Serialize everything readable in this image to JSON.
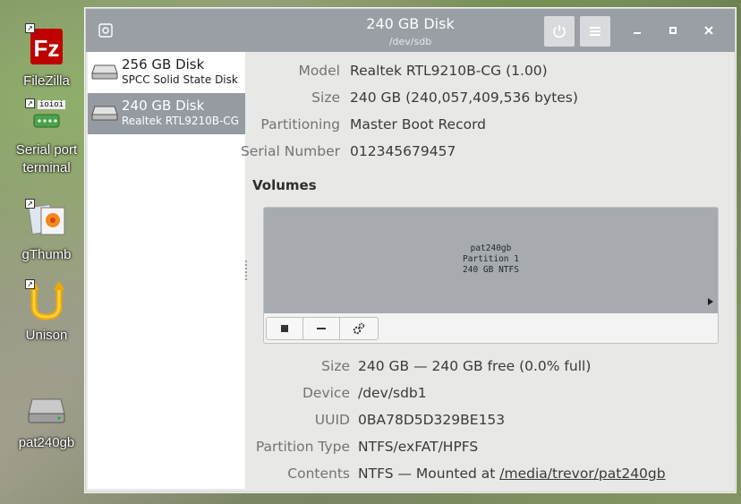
{
  "desktop": {
    "icons": [
      {
        "label": "FileZilla"
      },
      {
        "label": "Serial port\nterminal"
      },
      {
        "label": "gThumb"
      },
      {
        "label": "Unison"
      },
      {
        "label": "pat240gb"
      }
    ],
    "serial_badge": "ioioi"
  },
  "window": {
    "title": "240 GB Disk",
    "subtitle": "/dev/sdb",
    "accent": "#9a9fa6"
  },
  "sidebar": {
    "items": [
      {
        "name": "256 GB Disk",
        "sub": "SPCC Solid State Disk",
        "selected": false
      },
      {
        "name": "240 GB Disk",
        "sub": "Realtek RTL9210B-CG",
        "selected": true
      }
    ]
  },
  "drive": {
    "model_label": "Model",
    "model": "Realtek RTL9210B-CG (1.00)",
    "size_label": "Size",
    "size": "240 GB (240,057,409,536 bytes)",
    "partitioning_label": "Partitioning",
    "partitioning": "Master Boot Record",
    "serial_label": "Serial Number",
    "serial": "012345679457"
  },
  "volumes": {
    "heading": "Volumes",
    "partition": {
      "name": "pat240gb",
      "number": "Partition 1",
      "desc": "240 GB NTFS"
    }
  },
  "volume_info": {
    "size_label": "Size",
    "size": "240 GB — 240 GB free (0.0% full)",
    "device_label": "Device",
    "device": "/dev/sdb1",
    "uuid_label": "UUID",
    "uuid": "0BA78D5D329BE153",
    "ptype_label": "Partition Type",
    "ptype": "NTFS/exFAT/HPFS",
    "contents_label": "Contents",
    "contents_prefix": "NTFS — Mounted at ",
    "mount_point": "/media/trevor/pat240gb"
  }
}
